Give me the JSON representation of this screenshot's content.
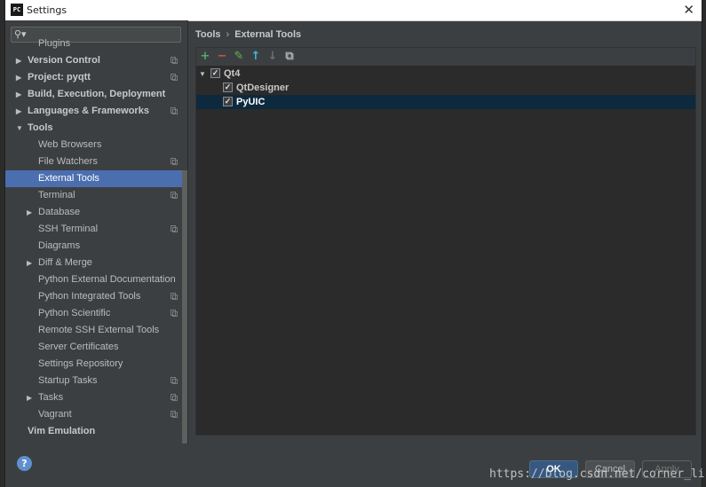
{
  "window": {
    "title": "Settings",
    "app_icon": "PC"
  },
  "search": {
    "placeholder": ""
  },
  "sidebar": {
    "items": [
      {
        "label": "Plugins",
        "bold": false,
        "indent": 1,
        "arrow": "",
        "copy": false
      },
      {
        "label": "Version Control",
        "bold": true,
        "indent": 0,
        "arrow": "right",
        "copy": true
      },
      {
        "label": "Project: pyqtt",
        "bold": true,
        "indent": 0,
        "arrow": "right",
        "copy": true
      },
      {
        "label": "Build, Execution, Deployment",
        "bold": true,
        "indent": 0,
        "arrow": "right",
        "copy": false
      },
      {
        "label": "Languages & Frameworks",
        "bold": true,
        "indent": 0,
        "arrow": "right",
        "copy": true
      },
      {
        "label": "Tools",
        "bold": true,
        "indent": 0,
        "arrow": "down",
        "copy": false
      },
      {
        "label": "Web Browsers",
        "bold": false,
        "indent": 1,
        "arrow": "",
        "copy": false
      },
      {
        "label": "File Watchers",
        "bold": false,
        "indent": 1,
        "arrow": "",
        "copy": true
      },
      {
        "label": "External Tools",
        "bold": false,
        "indent": 1,
        "arrow": "",
        "copy": false,
        "selected": true
      },
      {
        "label": "Terminal",
        "bold": false,
        "indent": 1,
        "arrow": "",
        "copy": true
      },
      {
        "label": "Database",
        "bold": false,
        "indent": 1,
        "arrow": "right",
        "copy": false
      },
      {
        "label": "SSH Terminal",
        "bold": false,
        "indent": 1,
        "arrow": "",
        "copy": true
      },
      {
        "label": "Diagrams",
        "bold": false,
        "indent": 1,
        "arrow": "",
        "copy": false
      },
      {
        "label": "Diff & Merge",
        "bold": false,
        "indent": 1,
        "arrow": "right",
        "copy": false
      },
      {
        "label": "Python External Documentation",
        "bold": false,
        "indent": 1,
        "arrow": "",
        "copy": false
      },
      {
        "label": "Python Integrated Tools",
        "bold": false,
        "indent": 1,
        "arrow": "",
        "copy": true
      },
      {
        "label": "Python Scientific",
        "bold": false,
        "indent": 1,
        "arrow": "",
        "copy": true
      },
      {
        "label": "Remote SSH External Tools",
        "bold": false,
        "indent": 1,
        "arrow": "",
        "copy": false
      },
      {
        "label": "Server Certificates",
        "bold": false,
        "indent": 1,
        "arrow": "",
        "copy": false
      },
      {
        "label": "Settings Repository",
        "bold": false,
        "indent": 1,
        "arrow": "",
        "copy": false
      },
      {
        "label": "Startup Tasks",
        "bold": false,
        "indent": 1,
        "arrow": "",
        "copy": true
      },
      {
        "label": "Tasks",
        "bold": false,
        "indent": 1,
        "arrow": "right",
        "copy": true
      },
      {
        "label": "Vagrant",
        "bold": false,
        "indent": 1,
        "arrow": "",
        "copy": true
      },
      {
        "label": "Vim Emulation",
        "bold": true,
        "indent": 0,
        "arrow": "",
        "copy": false
      }
    ]
  },
  "breadcrumb": {
    "root": "Tools",
    "separator": "›",
    "current": "External Tools"
  },
  "toolbar": {
    "add": "+",
    "remove": "−",
    "edit": "✎",
    "up": "↑",
    "down": "↓",
    "copy": "⧉",
    "colors": {
      "add": "#59a869",
      "remove": "#c75450",
      "edit": "#62b543",
      "up": "#40b6e0",
      "down": "#6e6e6e",
      "copy": "#afb1b3"
    }
  },
  "tools_tree": {
    "group": {
      "label": "Qt4",
      "checked": true
    },
    "children": [
      {
        "label": "QtDesigner",
        "checked": true,
        "selected": false
      },
      {
        "label": "PyUIC",
        "checked": true,
        "selected": true
      }
    ]
  },
  "footer": {
    "help": "?",
    "ok": "OK",
    "cancel": "Cancel",
    "apply": "Apply"
  },
  "watermark": "https://blog.csdn.net/corner_li"
}
